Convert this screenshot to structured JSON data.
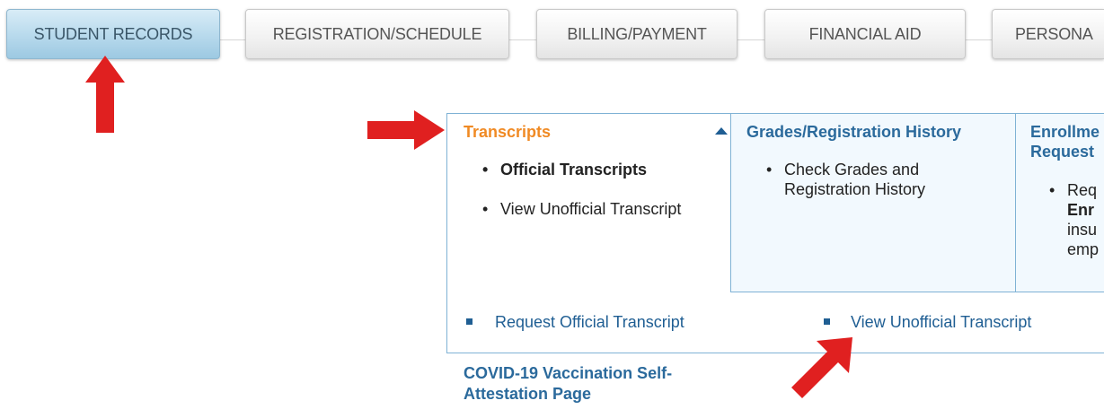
{
  "tabs": [
    {
      "label": "STUDENT RECORDS",
      "active": true
    },
    {
      "label": "REGISTRATION/SCHEDULE",
      "active": false
    },
    {
      "label": "BILLING/PAYMENT",
      "active": false
    },
    {
      "label": "FINANCIAL AID",
      "active": false
    },
    {
      "label": "PERSONA",
      "active": false
    }
  ],
  "menu": {
    "transcripts": {
      "title": "Transcripts",
      "items": [
        "Official Transcripts",
        "View Unofficial Transcript"
      ],
      "links": [
        "Request Official Transcript",
        "View Unofficial Transcript"
      ]
    },
    "grades": {
      "title": "Grades/Registration History",
      "items": [
        "Check Grades and",
        "Registration History"
      ]
    },
    "enrollment": {
      "title_lines": [
        "Enrollme",
        "Request"
      ],
      "item_lines": [
        "Req",
        "Enr",
        "insu",
        "emp"
      ]
    },
    "covid": {
      "title_lines": [
        "COVID-19 Vaccination Self-",
        "Attestation Page"
      ]
    }
  },
  "colors": {
    "arrow": "#e02020",
    "active_tab": "#b7d9ec",
    "highlight_title": "#f08a24",
    "link": "#1f5e93",
    "panel_bg": "#f2f9fe"
  },
  "icons": [
    "caret-up-icon",
    "arrow-up-annotation",
    "arrow-right-annotation",
    "arrow-diagonal-annotation"
  ]
}
